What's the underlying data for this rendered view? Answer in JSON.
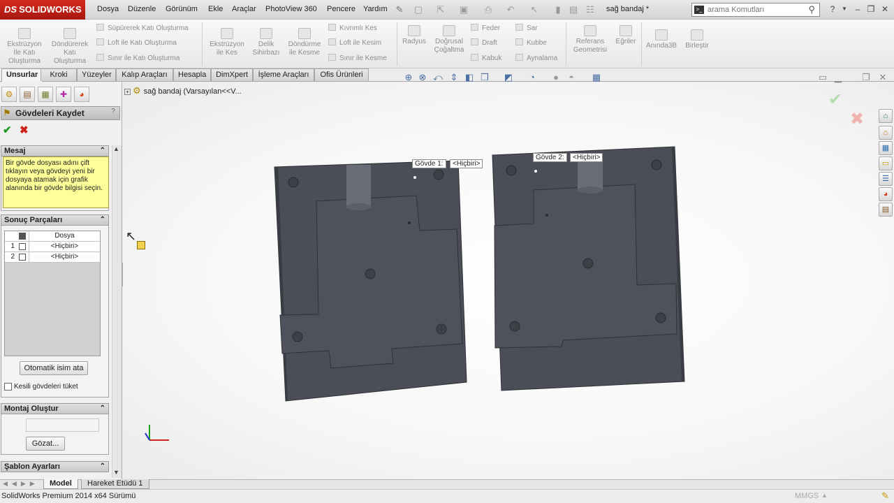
{
  "app": {
    "brand": "SOLIDWORKS",
    "brand_prefix": "DS",
    "doc_title": "sağ bandaj *"
  },
  "menu": [
    "Dosya",
    "Düzenle",
    "Görünüm",
    "Ekle",
    "Araçlar",
    "PhotoView 360",
    "Pencere",
    "Yardım"
  ],
  "search": {
    "placeholder": "arama Komutları"
  },
  "ribbon": {
    "big": [
      {
        "label": "Ekstrüzyon İle Katı Oluşturma",
        "icon": "extrude-boss-icon"
      },
      {
        "label": "Döndürerek Katı Oluşturma",
        "icon": "revolve-boss-icon"
      },
      {
        "label": "Ekstrüzyon ile Kes",
        "icon": "extrude-cut-icon"
      },
      {
        "label": "Delik Sihirbazı",
        "icon": "hole-wizard-icon"
      },
      {
        "label": "Döndürme ile Kesme",
        "icon": "revolve-cut-icon"
      },
      {
        "label": "Radyus",
        "icon": "fillet-icon"
      },
      {
        "label": "Doğrusal Çoğaltma",
        "icon": "linear-pattern-icon"
      },
      {
        "label": "Referans Geometrisi",
        "icon": "reference-geometry-icon"
      },
      {
        "label": "Eğriler",
        "icon": "curves-icon"
      },
      {
        "label": "Anında3B",
        "icon": "instant3d-icon"
      },
      {
        "label": "Birleştir",
        "icon": "combine-icon"
      }
    ],
    "small_col1": [
      "Süpürerek Katı Oluşturma",
      "Loft ile Katı Oluşturma",
      "Sınır ile Katı Oluşturma"
    ],
    "small_col2": [
      "Kıvrımlı Kes",
      "Loft ile Kesim",
      "Sınır ile Kesme"
    ],
    "small_col3": [
      "Feder",
      "Draft",
      "Kabuk"
    ],
    "small_col4": [
      "Sar",
      "Kubbe",
      "Aynalama"
    ]
  },
  "tabs": [
    "Unsurlar",
    "Kroki",
    "Yüzeyler",
    "Kalıp Araçları",
    "Hesapla",
    "DimXpert",
    "İşleme Araçları",
    "Ofis Ürünleri"
  ],
  "active_tab": "Unsurlar",
  "property_manager": {
    "title": "Gövdeleri Kaydet",
    "help": "?",
    "message_header": "Mesaj",
    "message": "Bir gövde dosyası adını çift tıklayın veya gövdeyi yeni bir dosyaya atamak için grafik alanında bir gövde bilgisi seçin.",
    "result_header": "Sonuç Parçaları",
    "column_file": "Dosya",
    "rows": [
      {
        "num": "1",
        "file": "<Hiçbiri>"
      },
      {
        "num": "2",
        "file": "<Hiçbiri>"
      }
    ],
    "auto_name_button": "Otomatik isim ata",
    "consume_checkbox": "Kesili gövdeleri tüket",
    "assembly_header": "Montaj Oluştur",
    "browse_button": "Gözat...",
    "template_header": "Şablon Ayarları"
  },
  "tree": {
    "root": "sağ bandaj  (Varsayılan<<V..."
  },
  "callouts": [
    {
      "label": "Gövde  1:",
      "value": "<Hiçbiri>"
    },
    {
      "label": "Gövde  2:",
      "value": "<Hiçbiri>"
    }
  ],
  "bottom_tabs": [
    "Model",
    "Hareket Etüdü 1"
  ],
  "status": {
    "left": "SolidWorks Premium 2014 x64 Sürümü",
    "units": "MMGS"
  },
  "colors": {
    "brand": "#c8221a",
    "part": "#4a4d56",
    "message_bg": "#ffff99"
  }
}
